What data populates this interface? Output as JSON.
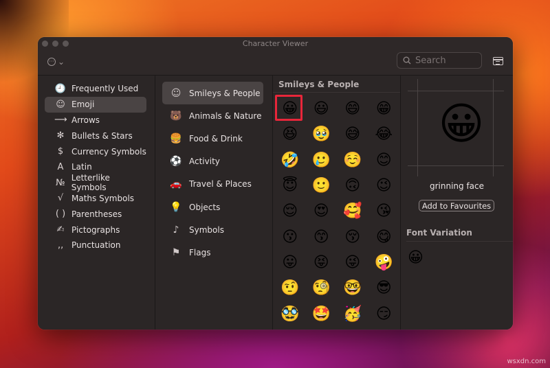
{
  "window": {
    "title": "Character Viewer"
  },
  "toolbar": {
    "more_icon": "ellipsis-circle-icon",
    "search_placeholder": "Search",
    "layout_icon": "grid-toggle-icon"
  },
  "sidebar": {
    "items": [
      {
        "label": "Frequently Used",
        "icon": "🕘",
        "selected": false
      },
      {
        "label": "Emoji",
        "icon": "☺",
        "selected": true
      },
      {
        "label": "Arrows",
        "icon": "⟶",
        "selected": false
      },
      {
        "label": "Bullets & Stars",
        "icon": "✻",
        "selected": false
      },
      {
        "label": "Currency Symbols",
        "icon": "$",
        "selected": false
      },
      {
        "label": "Latin",
        "icon": "A",
        "selected": false
      },
      {
        "label": "Letterlike Symbols",
        "icon": "№",
        "selected": false
      },
      {
        "label": "Maths Symbols",
        "icon": "√",
        "selected": false
      },
      {
        "label": "Parentheses",
        "icon": "( )",
        "selected": false
      },
      {
        "label": "Pictographs",
        "icon": "✍",
        "selected": false
      },
      {
        "label": "Punctuation",
        "icon": "‚‚",
        "selected": false
      }
    ]
  },
  "subcategories": {
    "items": [
      {
        "label": "Smileys & People",
        "icon": "☺",
        "selected": true
      },
      {
        "label": "Animals & Nature",
        "icon": "🐻",
        "selected": false
      },
      {
        "label": "Food & Drink",
        "icon": "🍔",
        "selected": false
      },
      {
        "label": "Activity",
        "icon": "⚽",
        "selected": false
      },
      {
        "label": "Travel & Places",
        "icon": "🚗",
        "selected": false
      },
      {
        "label": "Objects",
        "icon": "💡",
        "selected": false
      },
      {
        "label": "Symbols",
        "icon": "♪",
        "selected": false
      },
      {
        "label": "Flags",
        "icon": "⚑",
        "selected": false
      }
    ]
  },
  "emoji_panel": {
    "heading": "Smileys & People",
    "emojis": [
      "😀",
      "😃",
      "😄",
      "😁",
      "😆",
      "🥹",
      "😅",
      "😂",
      "🤣",
      "🥲",
      "☺️",
      "😊",
      "😇",
      "🙂",
      "🙃",
      "😉",
      "😌",
      "😍",
      "🥰",
      "😘",
      "😗",
      "😙",
      "😚",
      "😋",
      "😛",
      "😝",
      "😜",
      "🤪",
      "🤨",
      "🧐",
      "🤓",
      "😎",
      "🥸",
      "🤩",
      "🥳",
      "😏"
    ],
    "selected_index": 0
  },
  "detail": {
    "emoji": "😀",
    "name": "grinning face",
    "add_button": "Add to Favourites",
    "font_variation_heading": "Font Variation",
    "variation_emoji": "😀"
  },
  "watermark": "wsxdn.com"
}
